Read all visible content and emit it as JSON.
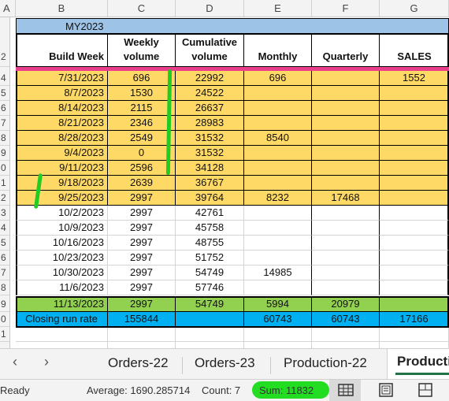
{
  "columns": {
    "A": "A",
    "B": "B",
    "C": "C",
    "D": "D",
    "E": "E",
    "F": "F",
    "G": "G"
  },
  "title_cell": "MY2023",
  "headers": {
    "build_week": "Build Week",
    "weekly_volume": "Weekly volume",
    "cumulative_volume": "Cumulative volume",
    "monthly": "Monthly",
    "quarterly": "Quarterly",
    "sales": "SALES"
  },
  "row_numbers": [
    "2",
    "",
    "4",
    "5",
    "6",
    "7",
    "8",
    "9",
    "0",
    "1",
    "2",
    "3",
    "4",
    "5",
    "6",
    "7",
    "8",
    "9",
    "0",
    "1"
  ],
  "rows": [
    {
      "week": "7/31/2023",
      "weekly": "696",
      "cumulative": "22992",
      "monthly": "696",
      "quarterly": "",
      "sales": "1552"
    },
    {
      "week": "8/7/2023",
      "weekly": "1530",
      "cumulative": "24522",
      "monthly": "",
      "quarterly": "",
      "sales": ""
    },
    {
      "week": "8/14/2023",
      "weekly": "2115",
      "cumulative": "26637",
      "monthly": "",
      "quarterly": "",
      "sales": ""
    },
    {
      "week": "8/21/2023",
      "weekly": "2346",
      "cumulative": "28983",
      "monthly": "",
      "quarterly": "",
      "sales": ""
    },
    {
      "week": "8/28/2023",
      "weekly": "2549",
      "cumulative": "31532",
      "monthly": "8540",
      "quarterly": "",
      "sales": ""
    },
    {
      "week": "9/4/2023",
      "weekly": "0",
      "cumulative": "31532",
      "monthly": "",
      "quarterly": "",
      "sales": ""
    },
    {
      "week": "9/11/2023",
      "weekly": "2596",
      "cumulative": "34128",
      "monthly": "",
      "quarterly": "",
      "sales": ""
    },
    {
      "week": "9/18/2023",
      "weekly": "2639",
      "cumulative": "36767",
      "monthly": "",
      "quarterly": "",
      "sales": ""
    },
    {
      "week": "9/25/2023",
      "weekly": "2997",
      "cumulative": "39764",
      "monthly": "8232",
      "quarterly": "17468",
      "sales": ""
    },
    {
      "week": "10/2/2023",
      "weekly": "2997",
      "cumulative": "42761",
      "monthly": "",
      "quarterly": "",
      "sales": ""
    },
    {
      "week": "10/9/2023",
      "weekly": "2997",
      "cumulative": "45758",
      "monthly": "",
      "quarterly": "",
      "sales": ""
    },
    {
      "week": "10/16/2023",
      "weekly": "2997",
      "cumulative": "48755",
      "monthly": "",
      "quarterly": "",
      "sales": ""
    },
    {
      "week": "10/23/2023",
      "weekly": "2997",
      "cumulative": "51752",
      "monthly": "",
      "quarterly": "",
      "sales": ""
    },
    {
      "week": "10/30/2023",
      "weekly": "2997",
      "cumulative": "54749",
      "monthly": "14985",
      "quarterly": "",
      "sales": ""
    },
    {
      "week": "11/6/2023",
      "weekly": "2997",
      "cumulative": "57746",
      "monthly": "",
      "quarterly": "",
      "sales": ""
    }
  ],
  "total_row": {
    "week": "11/13/2023",
    "weekly": "2997",
    "cumulative": "54749",
    "monthly": "5994",
    "quarterly": "20979",
    "sales": ""
  },
  "closing_row": {
    "week": "Closing run rate",
    "weekly": "155844",
    "cumulative": "",
    "monthly": "60743",
    "quarterly": "60743",
    "sales": "17166"
  },
  "tabs": [
    "Orders-22",
    "Orders-23",
    "Production-22",
    "Producti"
  ],
  "status": {
    "ready": "Ready",
    "average": "Average: 1690.285714",
    "count": "Count: 7",
    "sum": "Sum: 11832"
  },
  "colors": {
    "orange_fill": "#ffd966",
    "blue_header": "#9dc3e6",
    "green_fill": "#92d050",
    "cyan_fill": "#00b0f0",
    "pink_band": "#e83e8c",
    "annotation_green": "#22cc22",
    "excel_green": "#217346"
  }
}
